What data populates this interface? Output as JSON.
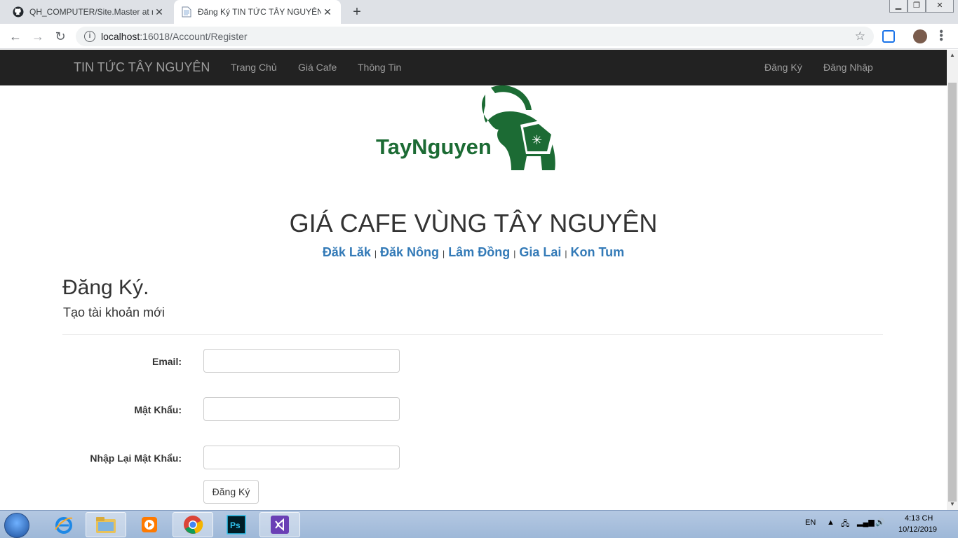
{
  "browser": {
    "tabs": [
      {
        "title": "QH_COMPUTER/Site.Master at m",
        "icon": "github-icon"
      },
      {
        "title": "Đăng Ký TIN TỨC TÂY NGUYÊN",
        "icon": "page-icon"
      }
    ],
    "url_host": "localhost",
    "url_path": ":16018/Account/Register"
  },
  "navbar": {
    "brand": "TIN TỨC TÂY NGUYÊN",
    "left_links": [
      "Trang Chủ",
      "Giá Cafe",
      "Thông Tin"
    ],
    "right_links": [
      "Đăng Ký",
      "Đăng Nhập"
    ]
  },
  "logo": {
    "text": "TayNguyen",
    "color": "#1c6b34"
  },
  "site_title": "GIÁ CAFE VÙNG TÂY NGUYÊN",
  "regions": [
    "Đăk Lăk",
    "Đăk Nông",
    "Lâm Đồng",
    "Gia Lai",
    "Kon Tum"
  ],
  "regions_sep": "|",
  "form": {
    "heading": "Đăng Ký.",
    "subheading": "Tạo tài khoản mới",
    "email_label": "Email:",
    "password_label": "Mật Khẩu:",
    "confirm_label": "Nhập Lại Mật Khẩu:",
    "email_value": "",
    "password_value": "",
    "confirm_value": "",
    "submit_label": "Đăng Ký"
  },
  "taskbar": {
    "apps": [
      "ie-icon",
      "explorer-icon",
      "media-player-icon",
      "chrome-icon",
      "photoshop-icon",
      "visual-studio-icon"
    ],
    "lang": "EN",
    "time": "4:13 CH",
    "date": "10/12/2019"
  },
  "colors": {
    "navbar_bg": "#222222",
    "link": "#337ab7",
    "accent": "#1c6b34"
  }
}
